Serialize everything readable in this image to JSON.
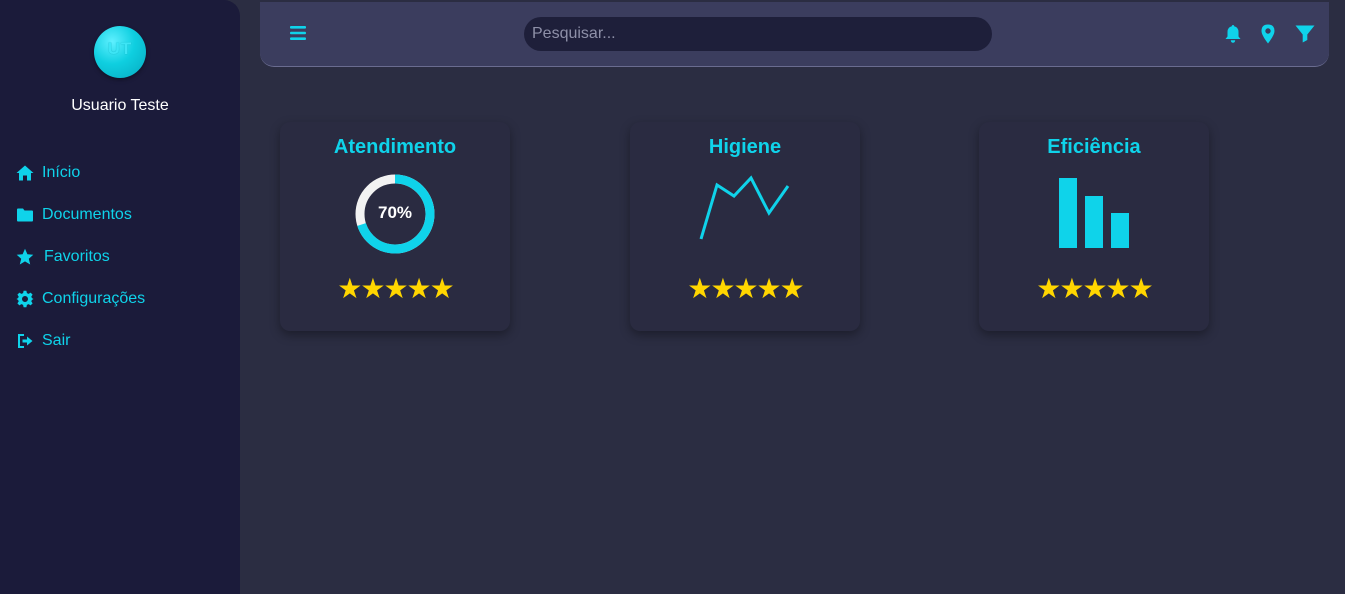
{
  "user": {
    "initials": "UT",
    "name": "Usuario Teste"
  },
  "nav": [
    {
      "label": "Início",
      "icon": "home-icon"
    },
    {
      "label": "Documentos",
      "icon": "folder-icon"
    },
    {
      "label": "Favoritos",
      "icon": "star-icon"
    },
    {
      "label": "Configurações",
      "icon": "gear-icon"
    },
    {
      "label": "Sair",
      "icon": "sign-out-icon"
    }
  ],
  "topbar": {
    "search_placeholder": "Pesquisar...",
    "icons": [
      "menu-icon",
      "bell-icon",
      "map-pin-icon",
      "filter-icon"
    ]
  },
  "cards": [
    {
      "title": "Atendimento",
      "value_label": "70%",
      "progress": 0.7,
      "rating": 5,
      "stars": "★★★★★"
    },
    {
      "title": "Higiene",
      "rating": 5,
      "stars": "★★★★★"
    },
    {
      "title": "Eficiência",
      "rating": 5,
      "stars": "★★★★★"
    }
  ],
  "colors": {
    "accent": "#0fd3ea",
    "sidebar": "#1b1b3a",
    "background": "#2b2d42",
    "topbar": "#3b3d5e",
    "star": "#ffd600"
  }
}
